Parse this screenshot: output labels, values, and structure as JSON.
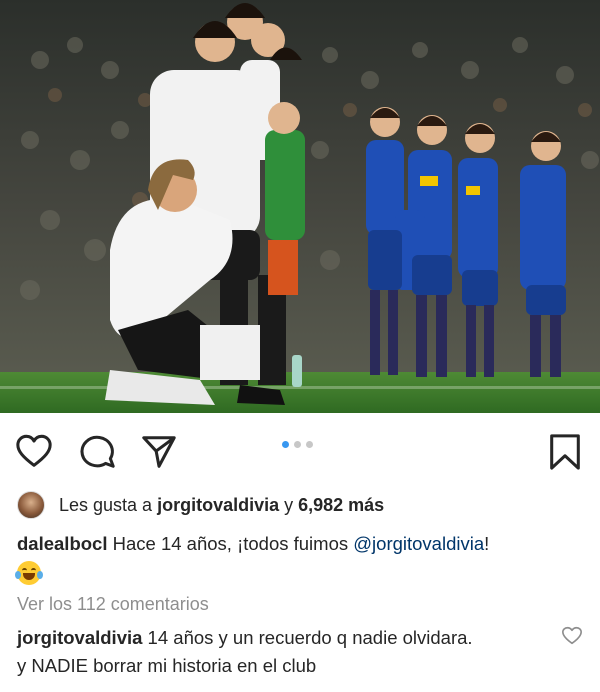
{
  "post": {
    "photo_alt": "",
    "carousel": {
      "count": 3,
      "active": 0
    }
  },
  "icons": {
    "like": "heart-icon",
    "comment": "comment-bubble-icon",
    "share": "paper-plane-icon",
    "save": "bookmark-icon"
  },
  "likes": {
    "prefix": "Les gusta a ",
    "user": "jorgitovaldivia",
    "middle": " y ",
    "count": "6,982 más"
  },
  "caption": {
    "user": "dalealbocl",
    "text_before": " Hace 14 años, ¡todos fuimos ",
    "mention": "@jorgitovaldivia",
    "text_after": "!",
    "emoji": "face-with-tears-of-joy"
  },
  "view_comments": "Ver los 112 comentarios",
  "comment": {
    "user": "jorgitovaldivia",
    "line1": " 14 años y un recuerdo q nadie olvidara.",
    "line2": "y NADIE  borrar mi historia en el club"
  },
  "colors": {
    "accent_blue": "#3897f0",
    "mention": "#003569",
    "muted": "#8e8e8e",
    "text": "#262626"
  }
}
